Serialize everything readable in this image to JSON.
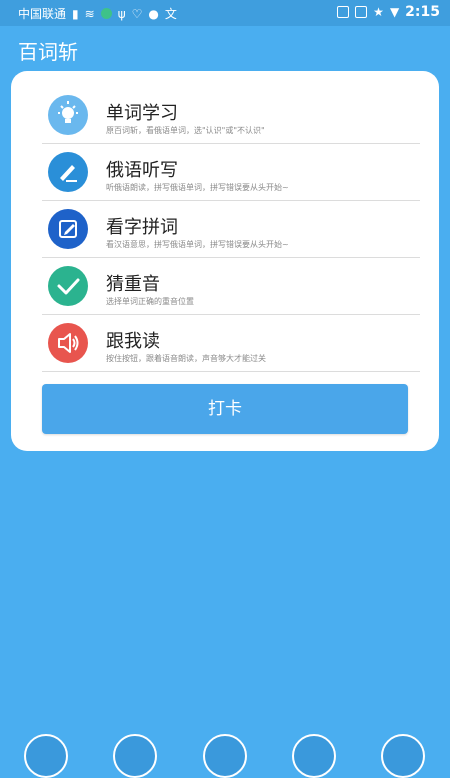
{
  "status_bar": {
    "carrier": "中国联通",
    "time": "2:15"
  },
  "app": {
    "title": "百词斩"
  },
  "menu": [
    {
      "title": "单词学习",
      "desc": "原百词斩，看俄语单词，选\"认识\"或\"不认识\"",
      "icon": "lightbulb-icon",
      "color": "#6ab8ee"
    },
    {
      "title": "俄语听写",
      "desc": "听俄语朗读，拼写俄语单词，拼写错误要从头开始~",
      "icon": "pen-icon",
      "color": "#2a8fd8"
    },
    {
      "title": "看字拼词",
      "desc": "看汉语意思，拼写俄语单词，拼写错误要从头开始~",
      "icon": "edit-icon",
      "color": "#1e62c9"
    },
    {
      "title": "猜重音",
      "desc": "选择单词正确的重音位置",
      "icon": "check-icon",
      "color": "#2bb38f"
    },
    {
      "title": "跟我读",
      "desc": "按住按钮，跟着语音朗读，声音够大才能过关",
      "icon": "speaker-icon",
      "color": "#e8554e"
    }
  ],
  "checkin_label": "打卡"
}
